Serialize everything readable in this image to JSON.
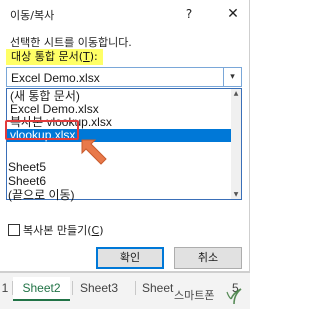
{
  "dialog": {
    "title": "이동/복사",
    "help_glyph": "?",
    "close_glyph": "✕",
    "instruction": "선택한 시트를 이동합니다.",
    "target_label_text": "대상 통합 문서",
    "target_label_hotkey": "T",
    "target_label_hotkey_paren_open": "(",
    "target_label_hotkey_paren_close": "):",
    "combo_value": "Excel Demo.xlsx",
    "combo_arrow": "▾",
    "workbook_options": [
      "(새 통합 문서)",
      "Excel Demo.xlsx",
      "복사본 vlookup.xlsx",
      "vlookup.xlsx"
    ],
    "selected_option_index": 3,
    "before_sheet_items": [
      "Sheet5",
      "Sheet6",
      "(끝으로 이동)"
    ],
    "copy_checkbox": {
      "label_text": "복사본 만들기",
      "hotkey": "C",
      "checked": false
    },
    "ok_label": "확인",
    "cancel_label": "취소"
  },
  "sheet_tabs": {
    "lead_tab": "1",
    "tabs": [
      "Sheet2",
      "Sheet3",
      "Sheet"
    ],
    "active_index": 0,
    "trailing_text": "5"
  },
  "watermark_text": "스마트폰",
  "colors": {
    "highlight": "#ffff66",
    "selection": "#0078d7",
    "annotation_red": "#e23b3b",
    "arrow_orange": "#e8794a",
    "excel_green": "#217346"
  },
  "icons": {
    "help": "question-icon",
    "close": "close-icon",
    "combo_arrow": "chevron-down-icon",
    "annotation_arrow": "pointer-arrow-icon"
  }
}
